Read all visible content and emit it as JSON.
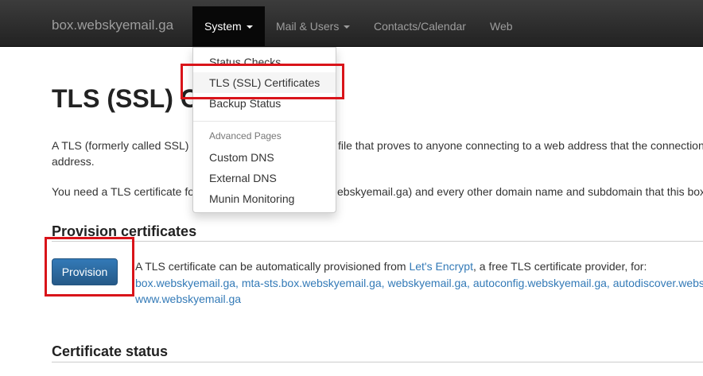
{
  "navbar": {
    "brand": "box.webskyemail.ga",
    "items": [
      {
        "label": "System",
        "dropdown": true,
        "active": true
      },
      {
        "label": "Mail & Users",
        "dropdown": true,
        "active": false
      },
      {
        "label": "Contacts/Calendar",
        "dropdown": false,
        "active": false
      },
      {
        "label": "Web",
        "dropdown": false,
        "active": false
      }
    ]
  },
  "dropdown": {
    "items": [
      "Status Checks",
      "TLS (SSL) Certificates",
      "Backup Status"
    ],
    "header": "Advanced Pages",
    "advanced_items": [
      "Custom DNS",
      "External DNS",
      "Munin Monitoring"
    ]
  },
  "page": {
    "title": "TLS (SSL) Ce",
    "intro_line1_start": "A TLS (formerly called SSL) c",
    "intro_line1_end": "file that proves to anyone connecting to a web address that the connection",
    "intro_line2": "address.",
    "need_start": "You need a TLS certificate fo",
    "need_end": "ebskyemail.ga) and every other domain name and subdomain that this box"
  },
  "provision": {
    "section_title": "Provision certificates",
    "button_label": "Provision",
    "text_before": "A TLS certificate can be automatically provisioned from ",
    "link_text": "Let's Encrypt",
    "text_after": ", a free TLS certificate provider, for:",
    "domains_line1": "box.webskyemail.ga, mta-sts.box.webskyemail.ga, webskyemail.ga, autoconfig.webskyemail.ga, autodiscover.websk",
    "domains_line2": "www.webskyemail.ga"
  },
  "status": {
    "section_title": "Certificate status"
  },
  "colors": {
    "navbar": "#222222",
    "link": "#337ab7",
    "button": "#337ab7",
    "highlight": "#d9141a"
  }
}
